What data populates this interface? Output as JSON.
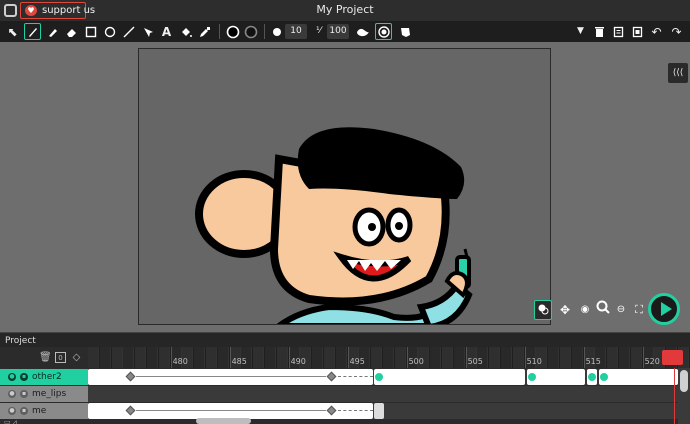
{
  "window": {
    "title": "My Project",
    "support_label": "support us"
  },
  "toolbar": {
    "brush_size": "10",
    "opacity": "100"
  },
  "panel": {
    "tab_label": "Project"
  },
  "timeline": {
    "ruler_labels": [
      "480",
      "485",
      "490",
      "495",
      "500",
      "505",
      "510",
      "515",
      "520"
    ],
    "layers": [
      {
        "name": "other2",
        "active": true
      },
      {
        "name": "me_lips",
        "active": false
      },
      {
        "name": "me",
        "active": false
      }
    ]
  },
  "colors": {
    "accent": "#20d0a0",
    "support": "#e0473d",
    "playhead": "#e23a3a",
    "skin": "#f8c99c",
    "hair": "#000000",
    "shirt": "#8ee0e4"
  },
  "icons": {
    "toolbar": [
      "select-icon",
      "brush-icon",
      "pen-icon",
      "eraser-icon",
      "rectangle-icon",
      "ellipse-icon",
      "line-icon",
      "node-edit-icon",
      "text-icon",
      "fill-icon",
      "eyedropper-icon",
      "stroke-color-icon",
      "fill-color-icon",
      "dot-icon",
      "opacity-icon",
      "smooth-icon",
      "onion-skin-icon",
      "mask-icon",
      "dropdown-icon",
      "trash-icon",
      "copy-icon",
      "paste-icon",
      "undo-icon",
      "redo-icon",
      "expand-icon"
    ]
  }
}
